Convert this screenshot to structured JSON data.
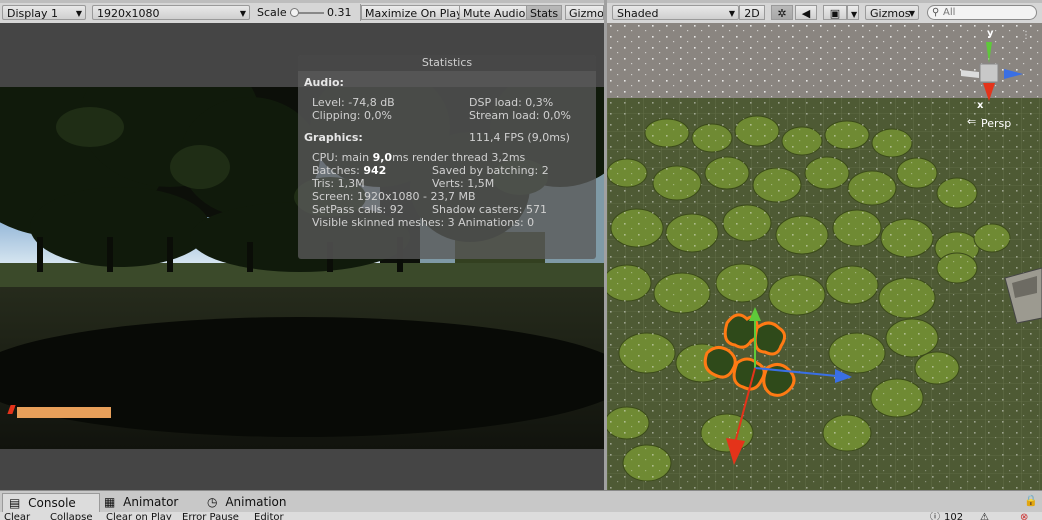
{
  "game_toolbar": {
    "display": "Display 1",
    "resolution": "1920x1080",
    "scale_label": "Scale",
    "scale_value": "0.31",
    "maximize": "Maximize On Play",
    "mute": "Mute Audio",
    "stats": "Stats",
    "gizmos": "Gizmos"
  },
  "scene_toolbar": {
    "shading": "Shaded",
    "mode_2d": "2D",
    "gizmos": "Gizmos",
    "search_placeholder": "All"
  },
  "scene": {
    "persp_label": "Persp",
    "axis_y": "y",
    "axis_x": "x"
  },
  "stats": {
    "title": "Statistics",
    "audio_header": "Audio:",
    "level": "Level: -74,8 dB",
    "dsp": "DSP load: 0,3%",
    "clipping": "Clipping: 0,0%",
    "stream": "Stream load: 0,0%",
    "graphics_header": "Graphics:",
    "fps": "111,4 FPS (9,0ms)",
    "cpu_prefix": "CPU: main ",
    "cpu_main": "9,0",
    "cpu_suffix": "ms  render thread 3,2ms",
    "batches_prefix": "Batches: ",
    "batches": "942",
    "saved": "Saved by batching: 2",
    "tris": "Tris: 1,3M",
    "verts": "Verts: 1,5M",
    "screen": "Screen: 1920x1080 - 23,7 MB",
    "setpass": "SetPass calls: 92",
    "shadow": "Shadow casters: 571",
    "visible": "Visible skinned meshes: 3  Animations: 0"
  },
  "bottom": {
    "tabs": [
      "Console",
      "Animator",
      "Animation"
    ],
    "buttons": [
      "Clear",
      "Collapse",
      "Clear on Play",
      "Error Pause",
      "Editor"
    ],
    "count": "102"
  },
  "colors": {
    "progress_bar": "#e8a05a",
    "selection_outline": "#ff7a14",
    "axis_red": "#e4331a",
    "axis_green": "#5ec93a",
    "axis_blue": "#3a6fe4"
  }
}
